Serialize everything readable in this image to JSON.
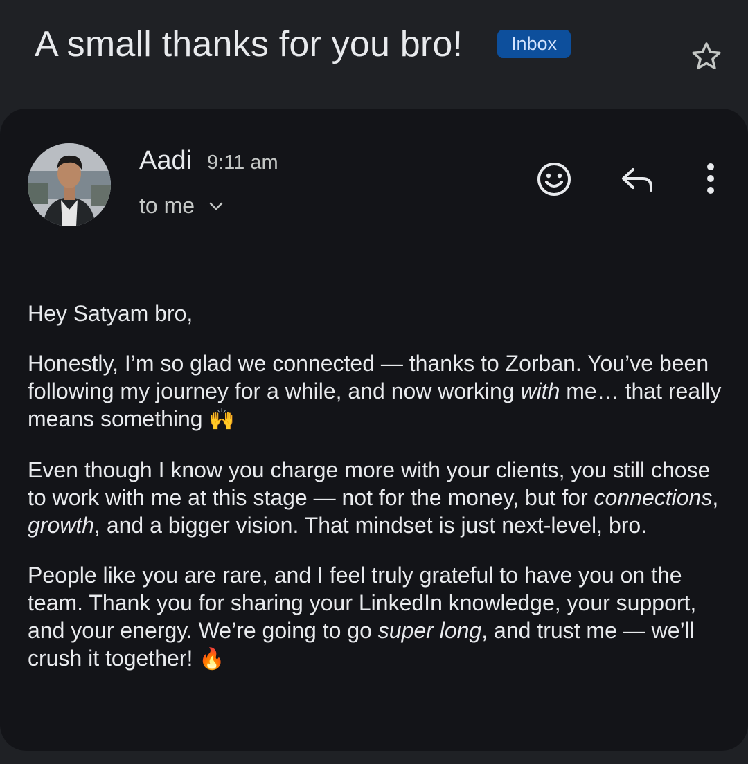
{
  "subject": "A small thanks for you bro!",
  "label_badge": "Inbox",
  "sender": {
    "name": "Aadi",
    "time": "9:11 am",
    "recipient": "to me"
  },
  "icons": [
    "star-icon",
    "emoji-icon",
    "reply-icon",
    "more-vert-icon",
    "chevron-down-icon"
  ],
  "colors": {
    "badge_bg": "#0d4f9c",
    "badge_text": "#d3e3fd",
    "card_bg": "#131418",
    "page_bg": "#1f2125"
  },
  "body": {
    "greeting": "Hey Satyam bro,",
    "p1_a": "Honestly, I’m so glad we connected — thanks to Zorban. You’ve been following my journey for a while, and now working ",
    "p1_em": "with",
    "p1_b": " me… that really means something ",
    "p1_emoji": "🙌",
    "p2_a": "Even though I know you charge more with your clients, you still chose to work with me at this stage — not for the money, but for ",
    "p2_em1": "connections",
    "p2_sep": ", ",
    "p2_em2": "growth",
    "p2_b": ", and a bigger vision. That mindset is just next-level, bro.",
    "p3_a": "People like you are rare, and I feel truly grateful to have you on the team. Thank you for sharing your LinkedIn knowledge, your support, and your energy. We’re going to go ",
    "p3_em": "super long",
    "p3_b": ", and trust me — we’ll crush it together! ",
    "p3_emoji": "🔥"
  }
}
